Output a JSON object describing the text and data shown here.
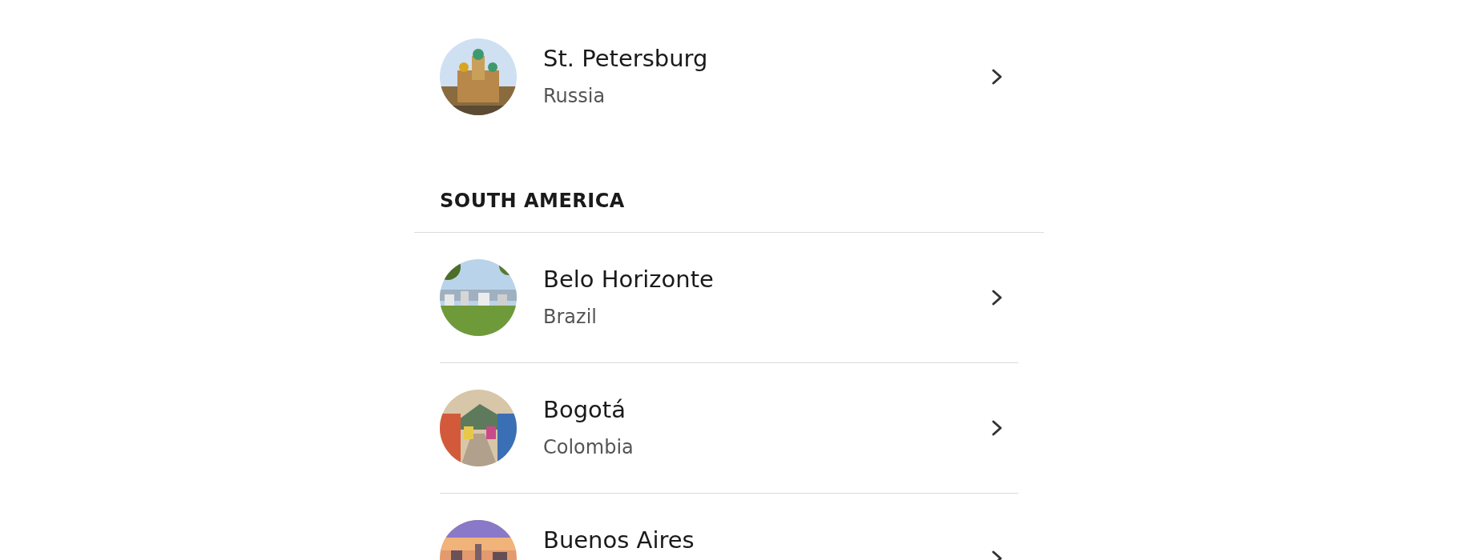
{
  "groups": [
    {
      "rows": [
        {
          "title": "St. Petersburg",
          "subtitle": "Russia"
        }
      ]
    },
    {
      "header": "SOUTH AMERICA",
      "rows": [
        {
          "title": "Belo Horizonte",
          "subtitle": "Brazil"
        },
        {
          "title": "Bogotá",
          "subtitle": "Colombia"
        },
        {
          "title": "Buenos Aires"
        }
      ]
    }
  ]
}
